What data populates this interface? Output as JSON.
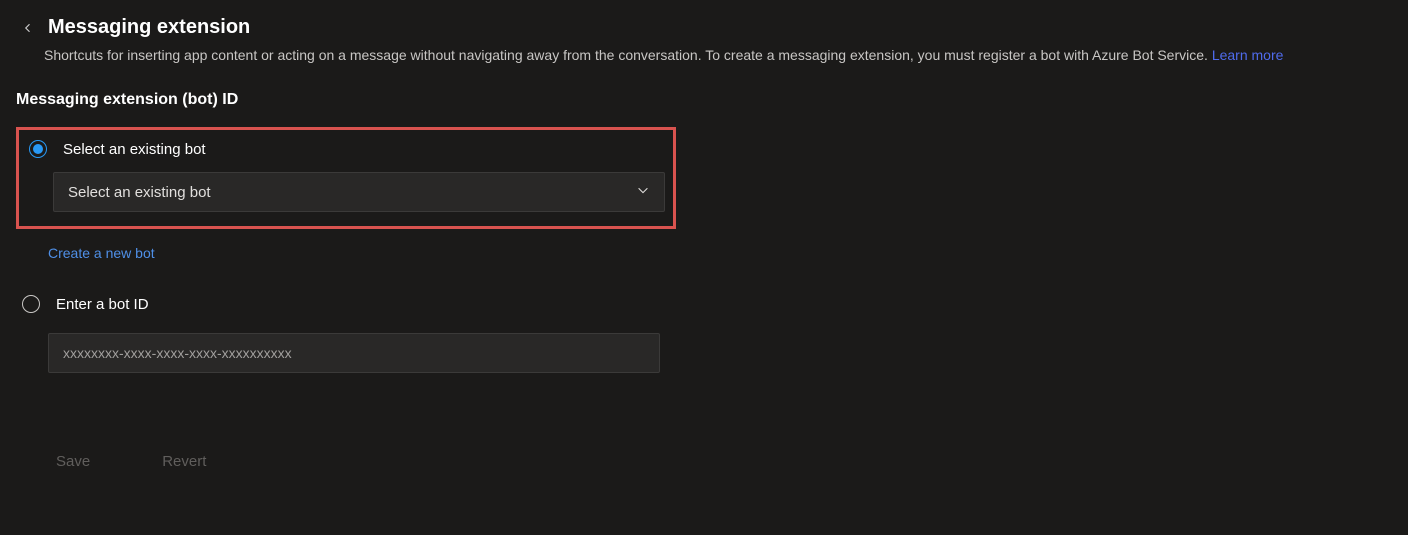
{
  "header": {
    "title": "Messaging extension",
    "description": "Shortcuts for inserting app content or acting on a message without navigating away from the conversation. To create a messaging extension, you must register a bot with Azure Bot Service. ",
    "learn_more": "Learn more"
  },
  "section": {
    "label": "Messaging extension (bot) ID",
    "option_select": {
      "label": "Select an existing bot",
      "selected": true,
      "dropdown_text": "Select an existing bot"
    },
    "create_link": "Create a new bot",
    "option_enter": {
      "label": "Enter a bot ID",
      "selected": false,
      "placeholder": "xxxxxxxx-xxxx-xxxx-xxxx-xxxxxxxxxx"
    }
  },
  "footer": {
    "save": "Save",
    "revert": "Revert"
  }
}
